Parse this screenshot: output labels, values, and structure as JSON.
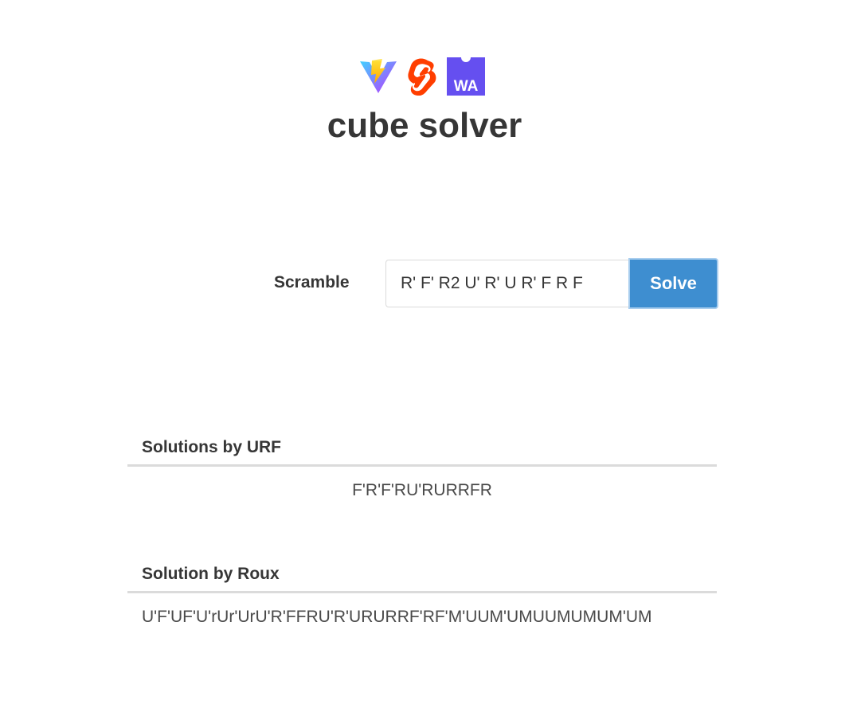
{
  "header": {
    "logos": [
      "vite-logo",
      "svelte-logo",
      "webassembly-logo"
    ],
    "wasm_logo_text": "WA",
    "title": "cube solver"
  },
  "scramble": {
    "label": "Scramble",
    "value": "R' F' R2 U' R' U R' F R F",
    "button_label": "Solve"
  },
  "solutions": {
    "urf": {
      "heading": "Solutions by URF",
      "result": "F'R'F'RU'RURRFR"
    },
    "roux": {
      "heading": "Solution by Roux",
      "result": "U'F'UF'U'rUr'UrU'R'FFRU'R'URURRF'RF'M'UUM'UMUUMUMUM'UM"
    }
  },
  "colors": {
    "text": "#363636",
    "solve_button_bg": "#3e8ed0",
    "solve_button_border": "#a8cdee",
    "divider": "#dbdbdb",
    "svelte_orange": "#ff3e00",
    "wasm_purple": "#654ff0"
  }
}
